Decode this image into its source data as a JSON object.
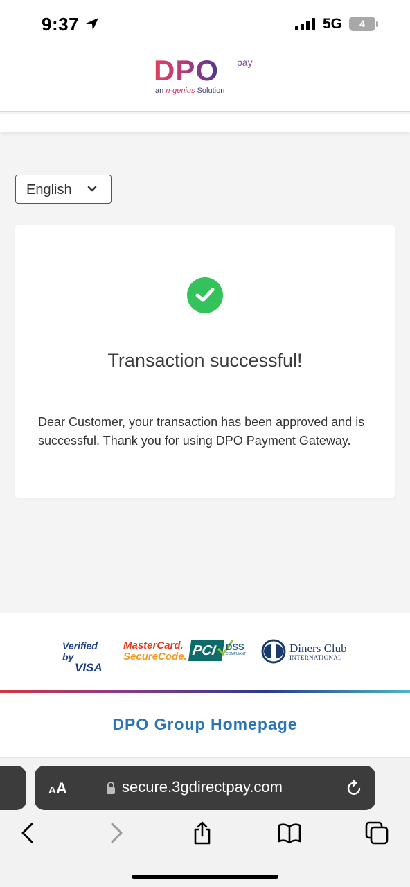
{
  "status_bar": {
    "time": "9:37",
    "network": "5G",
    "battery": "4"
  },
  "logo": {
    "main": "DPO",
    "pay": "pay",
    "sub_prefix": "an",
    "sub_brand": "n-genius",
    "sub_suffix": "Solution"
  },
  "language": {
    "selected": "English"
  },
  "result": {
    "title": "Transaction successful!",
    "message": "Dear Customer, your transaction has been approved and is successful. Thank you for using DPO Payment Gateway."
  },
  "footer": {
    "badges": {
      "visa_line1": "Verified by",
      "visa_line2": "VISA",
      "mastercard_line1": "MasterCard.",
      "mastercard_line2": "SecureCode.",
      "pci_main": "PCI",
      "pci_dss": "DSS",
      "pci_sub": "COMPLIANT",
      "diners_line1": "Diners Club",
      "diners_line2": "INTERNATIONAL"
    },
    "home_link": "DPO Group Homepage"
  },
  "browser": {
    "aa_small": "A",
    "aa_large": "A",
    "url": "secure.3gdirectpay.com"
  },
  "colors": {
    "success": "#34c35a",
    "link": "#2a75b5",
    "dpo_red": "#e1415f",
    "dpo_purple": "#4a3a8c"
  }
}
